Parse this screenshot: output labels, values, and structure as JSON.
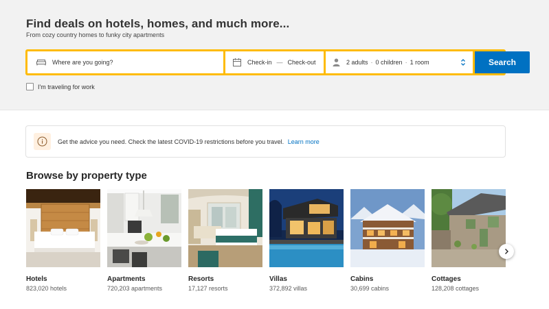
{
  "hero": {
    "title": "Find deals on hotels, homes, and much more...",
    "subtitle": "From cozy country homes to funky city apartments"
  },
  "search": {
    "destination_placeholder": "Where are you going?",
    "checkin": "Check-in",
    "date_separator": "—",
    "checkout": "Check-out",
    "adults": "2 adults",
    "children": "0 children",
    "rooms": "1 room",
    "separator": "·",
    "button_label": "Search",
    "work_travel_label": "I'm traveling for work",
    "work_travel_checked": false
  },
  "notice": {
    "text": "Get the advice you need. Check the latest COVID-19 restrictions before you travel.",
    "link": "Learn more"
  },
  "browse": {
    "title": "Browse by property type",
    "items": [
      {
        "name": "Hotels",
        "count": "823,020 hotels"
      },
      {
        "name": "Apartments",
        "count": "720,203 apartments"
      },
      {
        "name": "Resorts",
        "count": "17,127 resorts"
      },
      {
        "name": "Villas",
        "count": "372,892 villas"
      },
      {
        "name": "Cabins",
        "count": "30,699 cabins"
      },
      {
        "name": "Cottages",
        "count": "128,208 cottages"
      }
    ]
  },
  "colors": {
    "search_border": "#febb02",
    "search_button": "#0071c2",
    "link": "#0071c2",
    "hero_background": "#f2f2f2"
  },
  "icons": [
    "bed-icon",
    "calendar-icon",
    "person-icon",
    "stepper-icon",
    "info-icon",
    "chevron-right-icon"
  ]
}
